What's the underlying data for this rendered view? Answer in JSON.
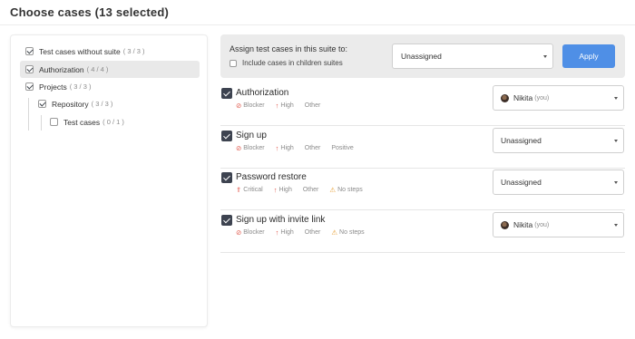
{
  "page": {
    "title": "Choose cases (13 selected)"
  },
  "tree": {
    "items": [
      {
        "label": "Test cases without suite",
        "count": "( 3 / 3 )",
        "checked": true
      },
      {
        "label": "Authorization",
        "count": "( 4 / 4 )",
        "checked": true
      },
      {
        "label": "Projects",
        "count": "( 3 / 3 )",
        "checked": true
      },
      {
        "label": "Repository",
        "count": "( 3 / 3 )",
        "checked": true
      },
      {
        "label": "Test cases",
        "count": "( 0 / 1 )",
        "checked": false
      }
    ]
  },
  "assign": {
    "title": "Assign test cases in this suite to:",
    "include_label": "Include cases in children suites",
    "select_value": "Unassigned",
    "apply_label": "Apply"
  },
  "cases": [
    {
      "name": "Authorization",
      "tags": [
        {
          "icon": "blocker-icon",
          "glyph": "⊘",
          "label": "Blocker"
        },
        {
          "icon": "arrow-up-icon",
          "glyph": "↑",
          "label": "High"
        },
        {
          "icon": "",
          "glyph": "",
          "label": "Other"
        }
      ],
      "assignee": {
        "name": "Nikita",
        "suffix": "(you)",
        "avatar": true
      }
    },
    {
      "name": "Sign up",
      "tags": [
        {
          "icon": "blocker-icon",
          "glyph": "⊘",
          "label": "Blocker"
        },
        {
          "icon": "arrow-up-icon",
          "glyph": "↑",
          "label": "High"
        },
        {
          "icon": "",
          "glyph": "",
          "label": "Other"
        },
        {
          "icon": "",
          "glyph": "",
          "label": "Positive"
        }
      ],
      "assignee": {
        "name": "Unassigned",
        "suffix": "",
        "avatar": false
      }
    },
    {
      "name": "Password restore",
      "tags": [
        {
          "icon": "double-arrow-up-icon",
          "glyph": "⇑",
          "label": "Critical"
        },
        {
          "icon": "arrow-up-icon",
          "glyph": "↑",
          "label": "High"
        },
        {
          "icon": "",
          "glyph": "",
          "label": "Other"
        },
        {
          "icon": "warning-icon",
          "glyph": "⚠",
          "label": "No steps"
        }
      ],
      "assignee": {
        "name": "Unassigned",
        "suffix": "",
        "avatar": false
      }
    },
    {
      "name": "Sign up with invite link",
      "tags": [
        {
          "icon": "blocker-icon",
          "glyph": "⊘",
          "label": "Blocker"
        },
        {
          "icon": "arrow-up-icon",
          "glyph": "↑",
          "label": "High"
        },
        {
          "icon": "",
          "glyph": "",
          "label": "Other"
        },
        {
          "icon": "warning-icon",
          "glyph": "⚠",
          "label": "No steps"
        }
      ],
      "assignee": {
        "name": "Nikita",
        "suffix": "(you)",
        "avatar": true
      }
    }
  ],
  "colors": {
    "accent": "#4f8fe6",
    "danger": "#e15b4f",
    "warning": "#e8a23a",
    "checkbox": "#3d4350"
  }
}
